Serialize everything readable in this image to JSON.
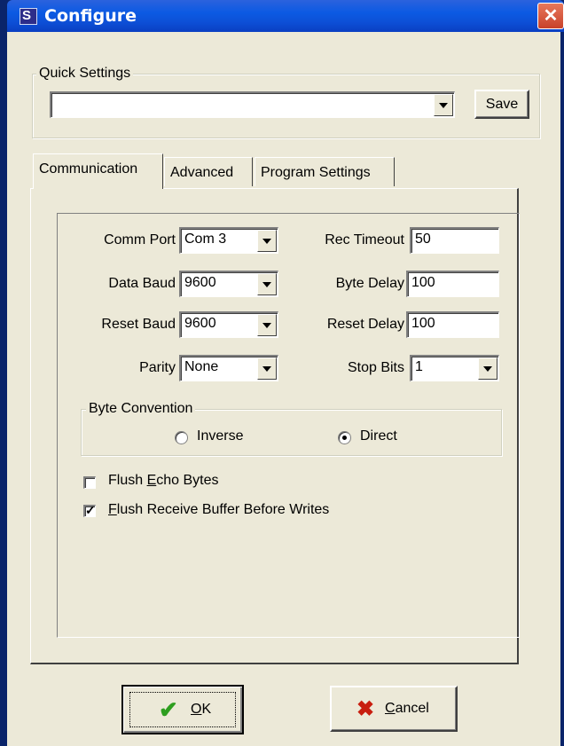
{
  "window": {
    "title": "Configure",
    "close_glyph": "✕",
    "icon": "configure-app-icon"
  },
  "quick_settings": {
    "group_label": "Quick Settings",
    "value": "",
    "save_label": "Save"
  },
  "tabs": [
    {
      "label": "Communication",
      "active": true
    },
    {
      "label": "Advanced",
      "active": false
    },
    {
      "label": "Program Settings",
      "active": false
    }
  ],
  "communication": {
    "comm_port_label": "Comm Port",
    "comm_port_value": "Com 3",
    "data_baud_label": "Data Baud",
    "data_baud_value": "9600",
    "reset_baud_label": "Reset Baud",
    "reset_baud_value": "9600",
    "parity_label": "Parity",
    "parity_value": "None",
    "rec_timeout_label": "Rec Timeout",
    "rec_timeout_value": "50",
    "byte_delay_label": "Byte Delay",
    "byte_delay_value": "100",
    "reset_delay_label": "Reset Delay",
    "reset_delay_value": "100",
    "stop_bits_label": "Stop Bits",
    "stop_bits_value": "1",
    "byte_convention": {
      "group_label": "Byte Convention",
      "options": [
        {
          "label": "Inverse",
          "checked": false
        },
        {
          "label": "Direct",
          "checked": true
        }
      ]
    },
    "flush_echo": {
      "label_pre": "Flush ",
      "label_u": "E",
      "label_post": "cho Bytes",
      "checked": false
    },
    "flush_receive": {
      "label_pre": "",
      "label_u": "F",
      "label_post": "lush Receive Buffer Before Writes",
      "checked": true
    }
  },
  "buttons": {
    "ok_u": "O",
    "ok_post": "K",
    "cancel_u": "C",
    "cancel_post": "ancel"
  },
  "colors": {
    "title_bar": "#0b5ae3",
    "dialog_face": "#ece9d8",
    "close_button": "#d9593f",
    "ok_check": "#2e9e1f",
    "cancel_x": "#c81e0f"
  }
}
